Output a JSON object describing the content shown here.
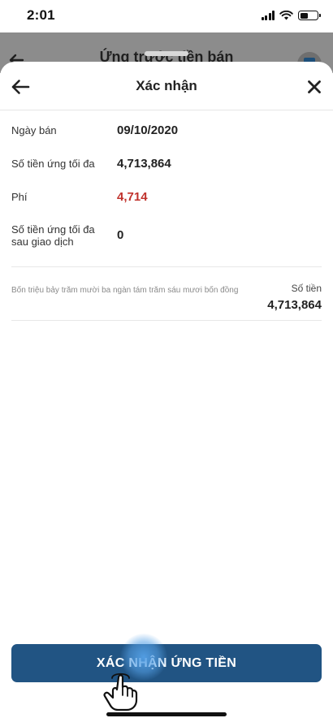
{
  "status_bar": {
    "time": "2:01"
  },
  "background_screen": {
    "title": "Ứng trước tiền bán"
  },
  "sheet": {
    "title": "Xác nhận",
    "back_icon": "arrow-left-icon",
    "close_icon": "close-icon"
  },
  "details": {
    "sale_date": {
      "label": "Ngày bán",
      "value": "09/10/2020"
    },
    "max_advance": {
      "label": "Số tiền ứng tối đa",
      "value": "4,713,864"
    },
    "fee": {
      "label": "Phí",
      "value": "4,714"
    },
    "max_after": {
      "label": "Số tiền ứng tối đa sau giao dịch",
      "value": "0"
    }
  },
  "amount": {
    "in_words": "Bốn triệu bảy trăm mười ba ngàn tám trăm sáu mươi bốn đồng",
    "caption": "Số tiền",
    "total": "4,713,864"
  },
  "confirm_button": {
    "label": "XÁC NHẬN ỨNG TIỀN"
  },
  "colors": {
    "primary": "#215483",
    "fee_text": "#c0322c",
    "touch_indicator": "#54a0e6"
  }
}
